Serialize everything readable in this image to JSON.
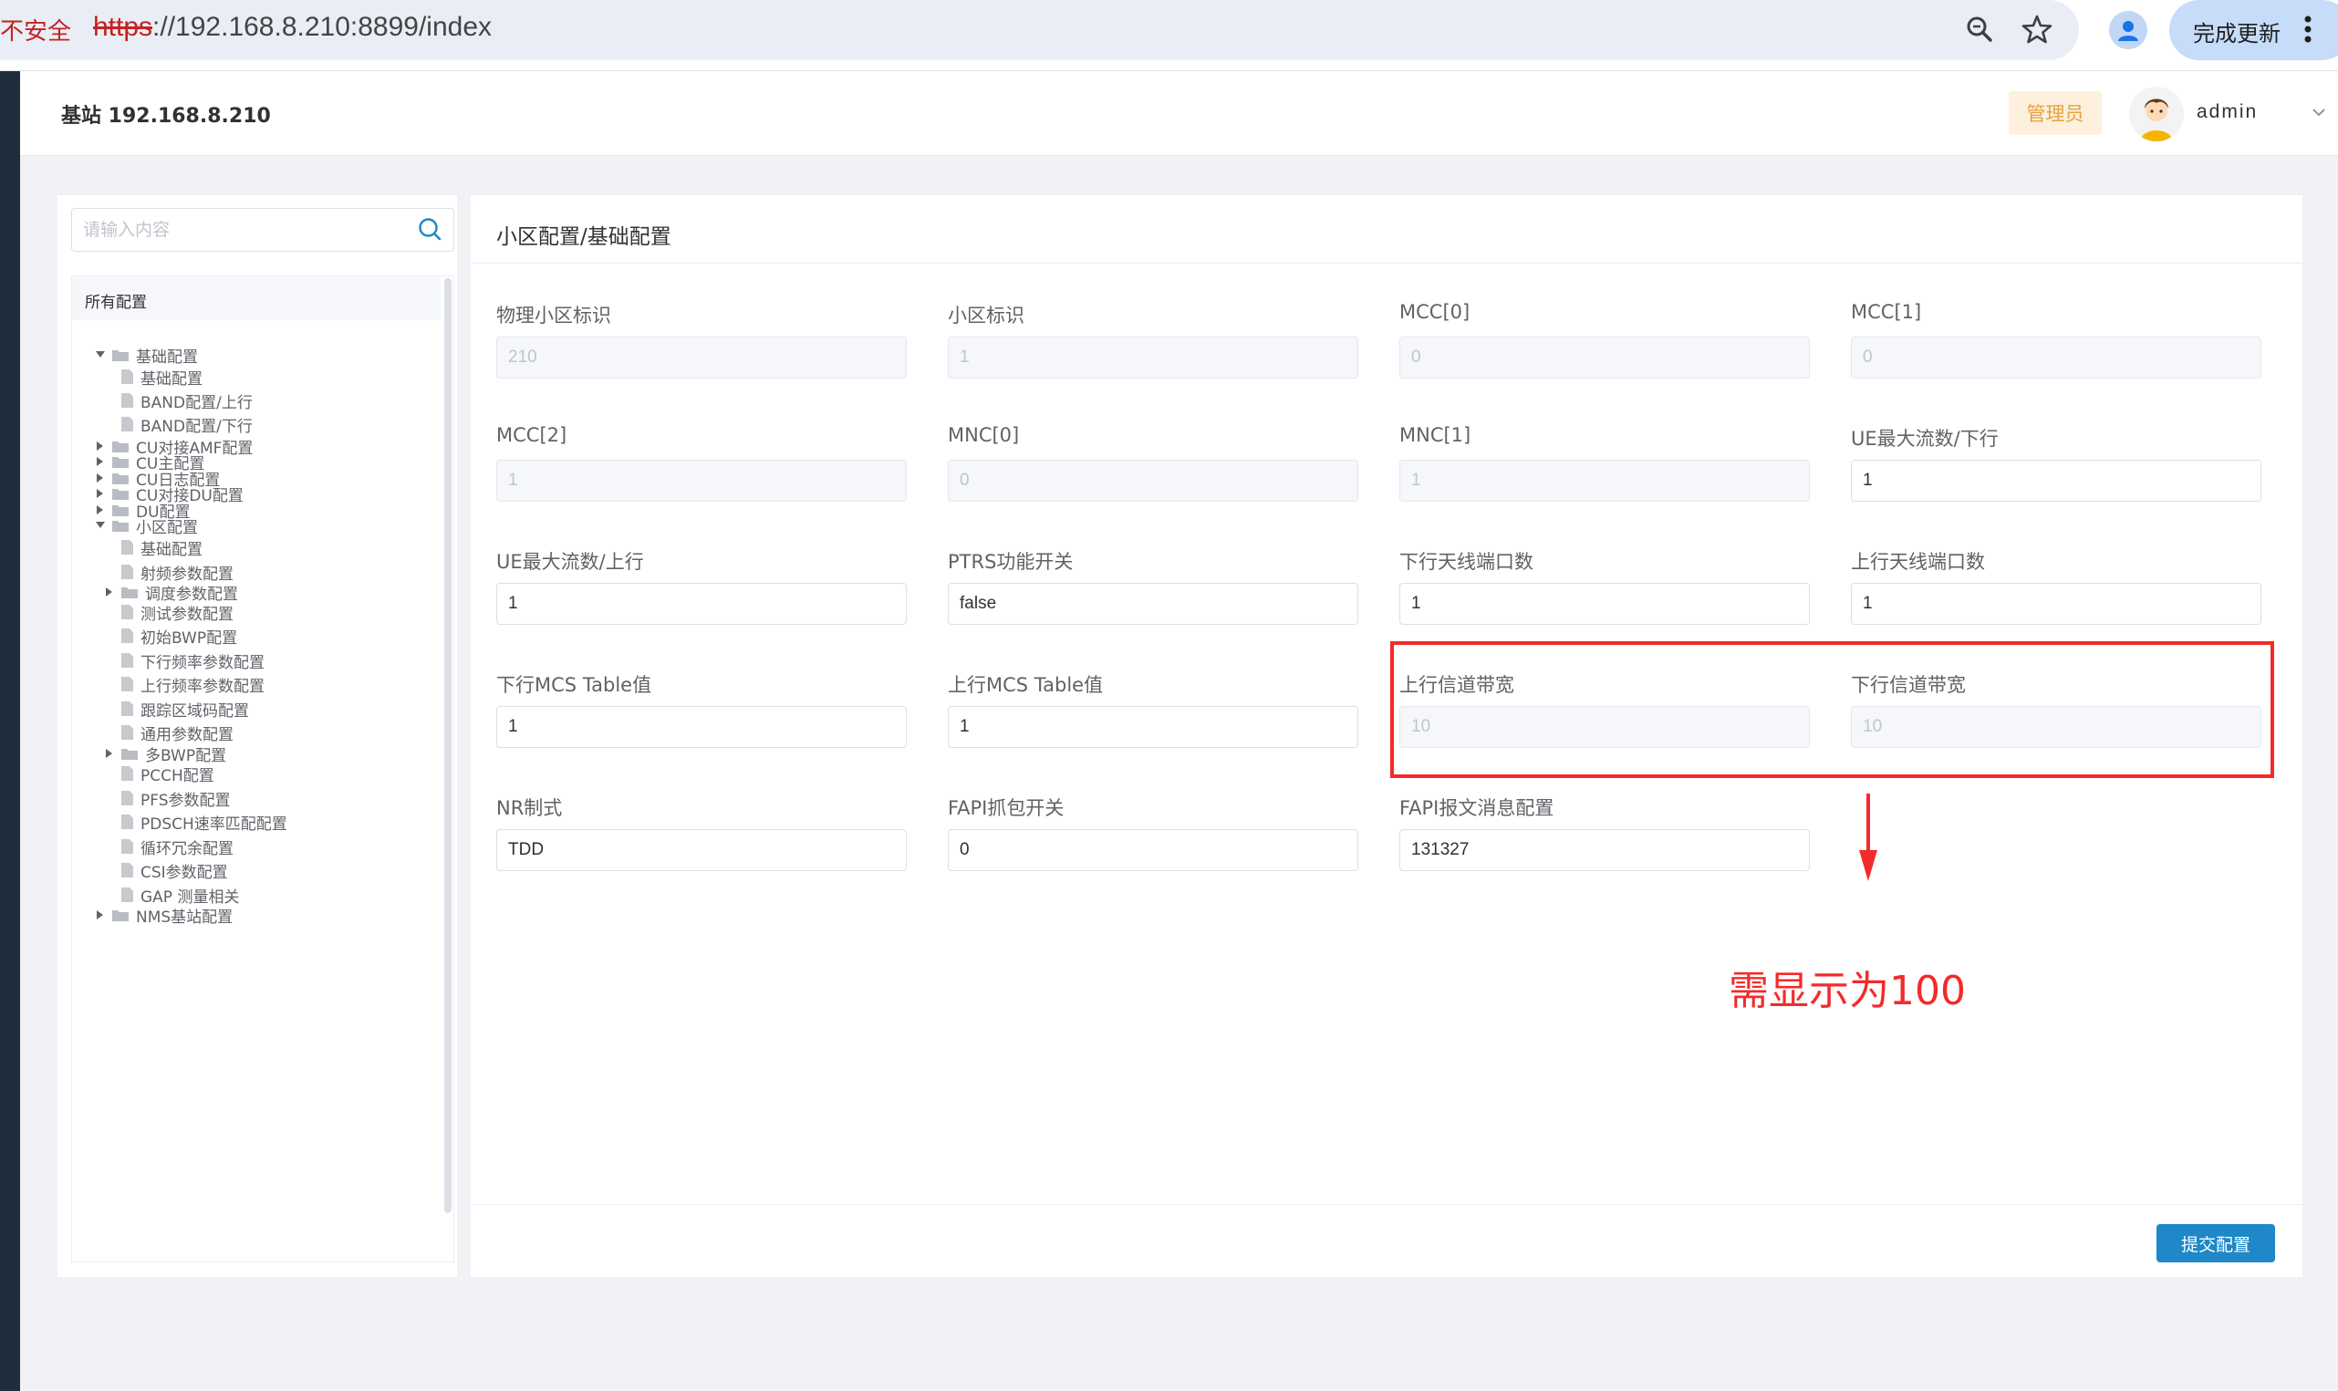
{
  "browser": {
    "security_label": "不安全",
    "url_scheme": "https",
    "url_rest": "://192.168.8.210:8899/index",
    "update_button": "完成更新"
  },
  "header": {
    "title": "基站 192.168.8.210",
    "role_badge": "管理员",
    "username": "admin"
  },
  "sidebar": {
    "search_placeholder": "请输入内容",
    "root_label": "所有配置",
    "tree": [
      {
        "label": "基础配置",
        "kind": "folder",
        "expanded": true
      },
      {
        "label": "基础配置",
        "kind": "file"
      },
      {
        "label": "BAND配置/上行",
        "kind": "file"
      },
      {
        "label": "BAND配置/下行",
        "kind": "file"
      },
      {
        "label": "CU对接AMF配置",
        "kind": "folder",
        "expanded": false
      },
      {
        "label": "CU主配置",
        "kind": "folder",
        "expanded": false
      },
      {
        "label": "CU日志配置",
        "kind": "folder",
        "expanded": false
      },
      {
        "label": "CU对接DU配置",
        "kind": "folder",
        "expanded": false
      },
      {
        "label": "DU配置",
        "kind": "folder",
        "expanded": false
      },
      {
        "label": "小区配置",
        "kind": "folder",
        "expanded": true
      },
      {
        "label": "基础配置",
        "kind": "file"
      },
      {
        "label": "射频参数配置",
        "kind": "file"
      },
      {
        "label": "调度参数配置",
        "kind": "folder",
        "expanded": false
      },
      {
        "label": "测试参数配置",
        "kind": "file"
      },
      {
        "label": "初始BWP配置",
        "kind": "file"
      },
      {
        "label": "下行频率参数配置",
        "kind": "file"
      },
      {
        "label": "上行频率参数配置",
        "kind": "file"
      },
      {
        "label": "跟踪区域码配置",
        "kind": "file"
      },
      {
        "label": "通用参数配置",
        "kind": "file"
      },
      {
        "label": "多BWP配置",
        "kind": "folder",
        "expanded": false
      },
      {
        "label": "PCCH配置",
        "kind": "file"
      },
      {
        "label": "PFS参数配置",
        "kind": "file"
      },
      {
        "label": "PDSCH速率匹配配置",
        "kind": "file"
      },
      {
        "label": "循环冗余配置",
        "kind": "file"
      },
      {
        "label": "CSI参数配置",
        "kind": "file"
      },
      {
        "label": "GAP 测量相关",
        "kind": "file"
      },
      {
        "label": "NMS基站配置",
        "kind": "folder",
        "expanded": false
      }
    ]
  },
  "main": {
    "breadcrumb": "小区配置/基础配置",
    "fields": [
      {
        "label": "物理小区标识",
        "value": "210",
        "disabled": true
      },
      {
        "label": "小区标识",
        "value": "1",
        "disabled": true
      },
      {
        "label": "MCC[0]",
        "value": "0",
        "disabled": true
      },
      {
        "label": "MCC[1]",
        "value": "0",
        "disabled": true
      },
      {
        "label": "MCC[2]",
        "value": "1",
        "disabled": true
      },
      {
        "label": "MNC[0]",
        "value": "0",
        "disabled": true
      },
      {
        "label": "MNC[1]",
        "value": "1",
        "disabled": true
      },
      {
        "label": "UE最大流数/下行",
        "value": "1",
        "disabled": false
      },
      {
        "label": "UE最大流数/上行",
        "value": "1",
        "disabled": false
      },
      {
        "label": "PTRS功能开关",
        "value": "false",
        "disabled": false
      },
      {
        "label": "下行天线端口数",
        "value": "1",
        "disabled": false
      },
      {
        "label": "上行天线端口数",
        "value": "1",
        "disabled": false
      },
      {
        "label": "下行MCS Table值",
        "value": "1",
        "disabled": false
      },
      {
        "label": "上行MCS Table值",
        "value": "1",
        "disabled": false
      },
      {
        "label": "上行信道带宽",
        "value": "10",
        "disabled": true
      },
      {
        "label": "下行信道带宽",
        "value": "10",
        "disabled": true
      },
      {
        "label": "NR制式",
        "value": "TDD",
        "disabled": false
      },
      {
        "label": "FAPI抓包开关",
        "value": "0",
        "disabled": false
      },
      {
        "label": "FAPI报文消息配置",
        "value": "131327",
        "disabled": false
      }
    ],
    "submit_button": "提交配置"
  },
  "annotation": {
    "text": "需显示为100",
    "color": "#f42a2a"
  },
  "colors": {
    "primary_button": "#1e88c8",
    "badge_text": "#e6a23c",
    "badge_bg": "#fdf0dd",
    "insecure": "#c5221f",
    "sidebar_dark": "#1f2d3d"
  }
}
